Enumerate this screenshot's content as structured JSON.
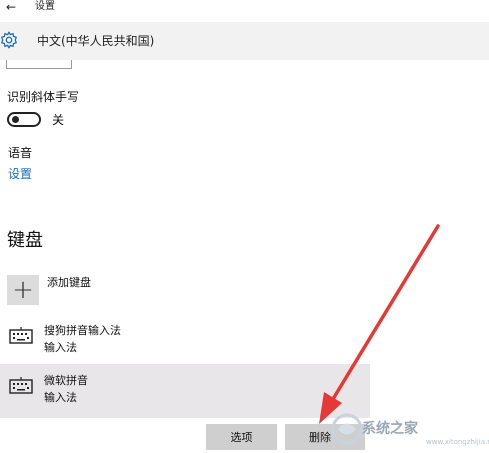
{
  "window": {
    "title": "设置"
  },
  "header": {
    "title": "中文(中华人民共和国)"
  },
  "handwriting": {
    "label": "识别斜体手写",
    "toggle_state": "关",
    "toggle_on": false
  },
  "voice": {
    "label": "语音",
    "link": "设置"
  },
  "keyboard": {
    "heading": "键盘",
    "add_label": "添加键盘",
    "add_symbol": "+",
    "items": [
      {
        "name": "搜狗拼音输入法",
        "type": "输入法",
        "selected": false
      },
      {
        "name": "微软拼音",
        "type": "输入法",
        "selected": true
      }
    ]
  },
  "buttons": {
    "options": "选项",
    "delete": "删除"
  },
  "watermark": {
    "text": "系统之家",
    "url": "www.xitongzhijia.net"
  },
  "colors": {
    "link": "#1a6bb5",
    "arrow": "#e53935",
    "selected_row": "#e8e6e9",
    "button": "#cfcfcf"
  }
}
